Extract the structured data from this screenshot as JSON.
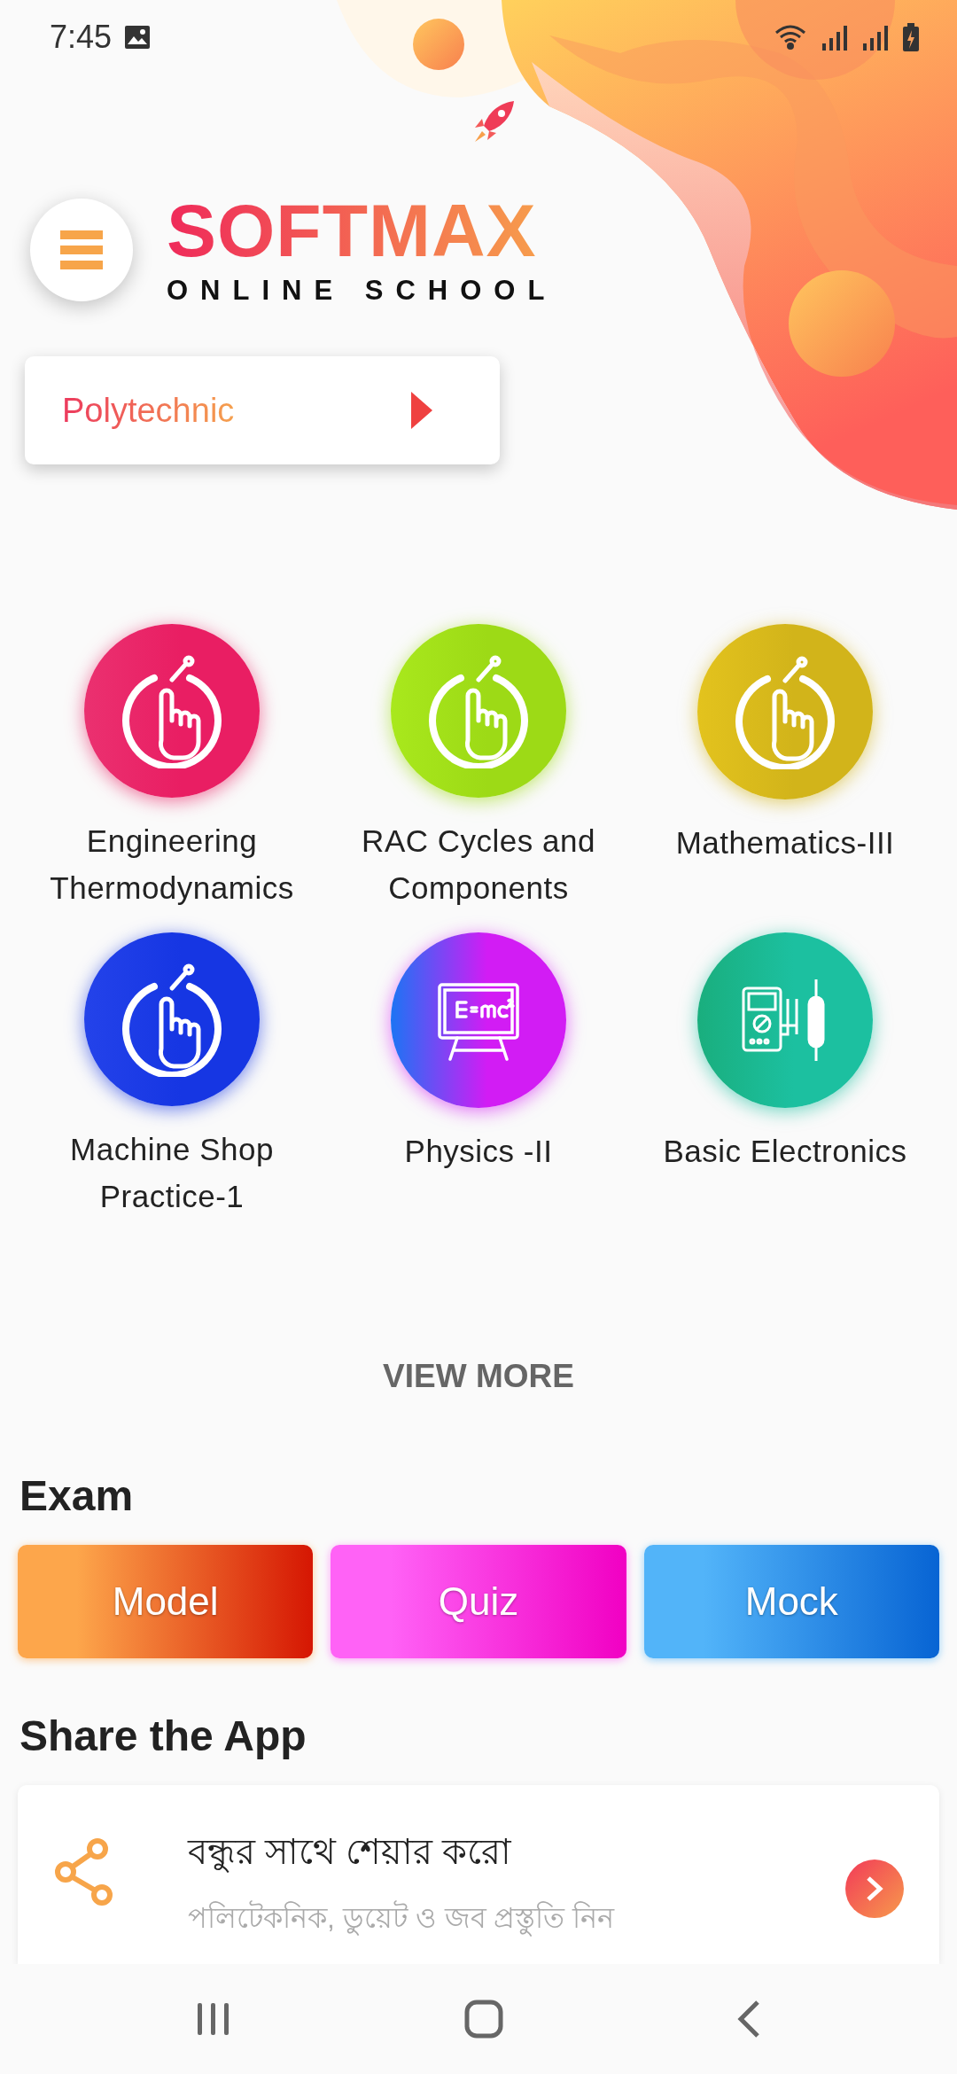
{
  "status_bar": {
    "time": "7:45"
  },
  "header": {
    "brand": "SOFTMAX",
    "tagline": "ONLINE SCHOOL",
    "category": "Polytechnic"
  },
  "courses": [
    {
      "title": "Engineering Thermodynamics",
      "kind": "pointer",
      "color": "#e91e63"
    },
    {
      "title": "RAC Cycles and Components",
      "kind": "pointer",
      "color": "#9dda16"
    },
    {
      "title": "Mathematics-III",
      "kind": "pointer",
      "color": "#d2b41a"
    },
    {
      "title": "Machine Shop Practice-1",
      "kind": "pointer",
      "color": "#1636e3"
    },
    {
      "title": "Physics -II",
      "kind": "formula",
      "color": "#d21cf4"
    },
    {
      "title": "Basic Electronics",
      "kind": "meter",
      "color": "#1cc0a0"
    }
  ],
  "view_more": "VIEW MORE",
  "exam": {
    "heading": "Exam",
    "buttons": [
      {
        "label": "Model",
        "color": "#fda64b"
      },
      {
        "label": "Quiz",
        "color": "#ff62f6"
      },
      {
        "label": "Mock",
        "color": "#52b4f9"
      }
    ]
  },
  "share": {
    "heading": "Share the App",
    "title": "বন্ধুর সাথে শেয়ার করো",
    "subtitle": "পলিটেকনিক, ডুয়েট ও জব প্রস্তুতি নিন"
  }
}
